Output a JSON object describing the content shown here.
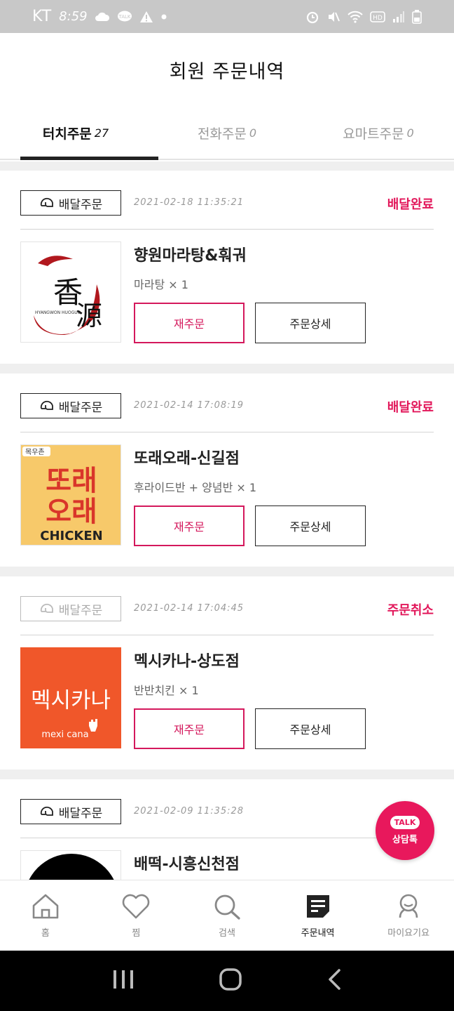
{
  "status_bar": {
    "carrier": "KT",
    "time": "8:59"
  },
  "header": {
    "title": "회원 주문내역"
  },
  "tabs": [
    {
      "label": "터치주문",
      "count": "27"
    },
    {
      "label": "전화주문",
      "count": "0"
    },
    {
      "label": "요마트주문",
      "count": "0"
    }
  ],
  "orders": [
    {
      "type": "배달주문",
      "date": "2021-02-18 11:35:21",
      "status": "배달완료",
      "store": "향원마라탕&훠궈",
      "menu": "마라탕 × 1",
      "reorder": "재주문",
      "detail": "주문상세",
      "logo_lines": [
        "香",
        "源"
      ],
      "logo_sub": "HYANGWON HUOGUO"
    },
    {
      "type": "배달주문",
      "date": "2021-02-14 17:08:19",
      "status": "배달완료",
      "store": "또래오래-신길점",
      "menu": "후라이드반 + 양념반 × 1",
      "reorder": "재주문",
      "detail": "주문상세",
      "logo_lines": [
        "또래",
        "오래"
      ],
      "logo_sub": "CHICKEN",
      "logo_tag": "목우촌"
    },
    {
      "type": "배달주문",
      "date": "2021-02-14 17:04:45",
      "status": "주문취소",
      "store": "멕시카나-상도점",
      "menu": "반반치킨 × 1",
      "reorder": "재주문",
      "detail": "주문상세",
      "logo_lines": [
        "멕시카나"
      ],
      "logo_sub": "mexi cana"
    },
    {
      "type": "배달주문",
      "date": "2021-02-09 11:35:28",
      "status": "",
      "store": "배떡-시흥신천점",
      "menu": "",
      "reorder": "",
      "detail": ""
    }
  ],
  "talk": {
    "bubble": "TALK",
    "label": "상담톡"
  },
  "nav": [
    {
      "label": "홈",
      "icon": "home-icon"
    },
    {
      "label": "찜",
      "icon": "heart-icon"
    },
    {
      "label": "검색",
      "icon": "search-icon"
    },
    {
      "label": "주문내역",
      "icon": "order-list-icon"
    },
    {
      "label": "마이요기요",
      "icon": "profile-icon"
    }
  ],
  "colors": {
    "accent": "#e2185b",
    "status_bar": "#c8c8c8"
  }
}
